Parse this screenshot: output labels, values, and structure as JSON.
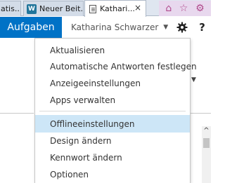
{
  "browser": {
    "tabs": [
      {
        "label": "atis...",
        "icon": "page-icon"
      },
      {
        "label": "Neuer Beit...",
        "icon": "wordpress-icon"
      },
      {
        "label": "Kathari...",
        "icon": "document-icon",
        "close": "×"
      }
    ],
    "toolbar_icons": [
      "⌂",
      "☆",
      "⚙"
    ]
  },
  "suitebar": {
    "app_name": "Aufgaben",
    "user_name": "Katharina Schwarzer",
    "user_caret": "▼",
    "help": "?",
    "brand_color": "#0072c6"
  },
  "background": {
    "caret": "▼",
    "fragment": "?\n41",
    "scroll_up": "^"
  },
  "menu": {
    "items": [
      {
        "label": "Aktualisieren"
      },
      {
        "label": "Automatische Antworten festlegen"
      },
      {
        "label": "Anzeigeeinstellungen"
      },
      {
        "label": "Apps verwalten"
      },
      {
        "label": "Offlineeinstellungen",
        "highlighted": true
      },
      {
        "label": "Design ändern"
      },
      {
        "label": "Kennwort ändern"
      },
      {
        "label": "Optionen"
      }
    ],
    "highlight_color": "#cde6f7"
  }
}
